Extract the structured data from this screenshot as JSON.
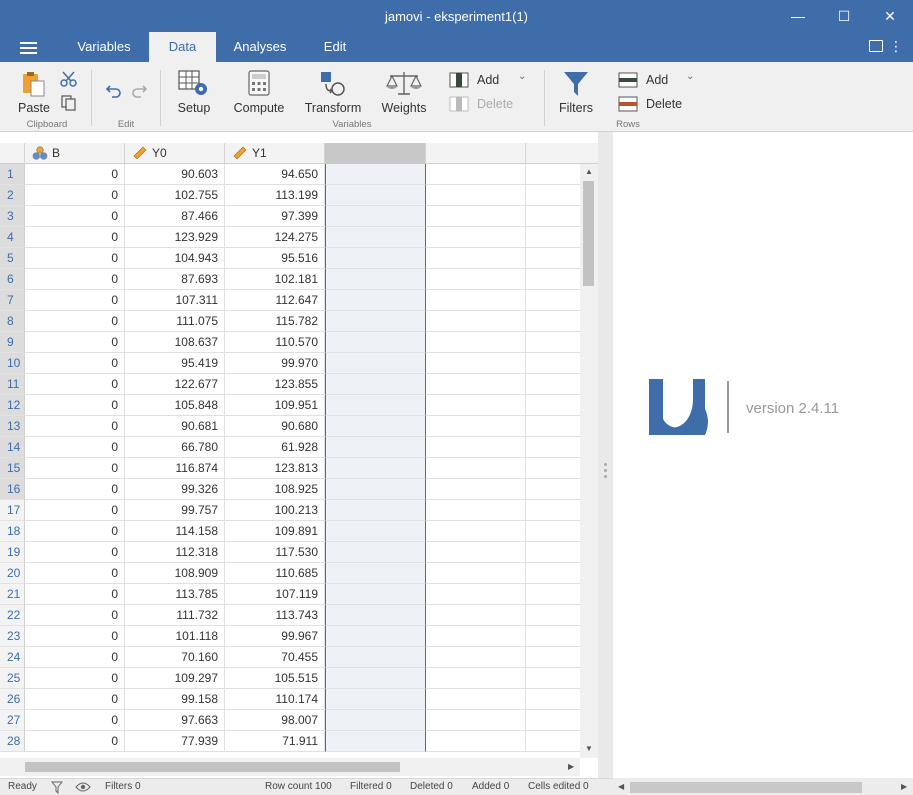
{
  "window": {
    "title": "jamovi - eksperiment1(1)",
    "minimize": "—",
    "maximize": "☐",
    "close": "✕"
  },
  "tabs": [
    {
      "label": "Variables"
    },
    {
      "label": "Data"
    },
    {
      "label": "Analyses"
    },
    {
      "label": "Edit"
    }
  ],
  "ribbon": {
    "paste": "Paste",
    "clipboard_group": "Clipboard",
    "edit_group": "Edit",
    "setup": "Setup",
    "compute": "Compute",
    "transform": "Transform",
    "weights": "Weights",
    "var_add": "Add",
    "var_delete": "Delete",
    "variables_group": "Variables",
    "filters": "Filters",
    "row_add": "Add",
    "row_delete": "Delete",
    "rows_group": "Rows"
  },
  "columns": [
    {
      "name": "B",
      "type": "nominal"
    },
    {
      "name": "Y0",
      "type": "continuous"
    },
    {
      "name": "Y1",
      "type": "continuous"
    }
  ],
  "rows": [
    {
      "n": "1",
      "B": "0",
      "Y0": "90.603",
      "Y1": "94.650"
    },
    {
      "n": "2",
      "B": "0",
      "Y0": "102.755",
      "Y1": "113.199"
    },
    {
      "n": "3",
      "B": "0",
      "Y0": "87.466",
      "Y1": "97.399"
    },
    {
      "n": "4",
      "B": "0",
      "Y0": "123.929",
      "Y1": "124.275"
    },
    {
      "n": "5",
      "B": "0",
      "Y0": "104.943",
      "Y1": "95.516"
    },
    {
      "n": "6",
      "B": "0",
      "Y0": "87.693",
      "Y1": "102.181"
    },
    {
      "n": "7",
      "B": "0",
      "Y0": "107.311",
      "Y1": "112.647"
    },
    {
      "n": "8",
      "B": "0",
      "Y0": "111.075",
      "Y1": "115.782"
    },
    {
      "n": "9",
      "B": "0",
      "Y0": "108.637",
      "Y1": "110.570"
    },
    {
      "n": "10",
      "B": "0",
      "Y0": "95.419",
      "Y1": "99.970"
    },
    {
      "n": "11",
      "B": "0",
      "Y0": "122.677",
      "Y1": "123.855"
    },
    {
      "n": "12",
      "B": "0",
      "Y0": "105.848",
      "Y1": "109.951"
    },
    {
      "n": "13",
      "B": "0",
      "Y0": "90.681",
      "Y1": "90.680"
    },
    {
      "n": "14",
      "B": "0",
      "Y0": "66.780",
      "Y1": "61.928"
    },
    {
      "n": "15",
      "B": "0",
      "Y0": "116.874",
      "Y1": "123.813"
    },
    {
      "n": "16",
      "B": "0",
      "Y0": "99.326",
      "Y1": "108.925"
    },
    {
      "n": "17",
      "B": "0",
      "Y0": "99.757",
      "Y1": "100.213"
    },
    {
      "n": "18",
      "B": "0",
      "Y0": "114.158",
      "Y1": "109.891"
    },
    {
      "n": "19",
      "B": "0",
      "Y0": "112.318",
      "Y1": "117.530"
    },
    {
      "n": "20",
      "B": "0",
      "Y0": "108.909",
      "Y1": "110.685"
    },
    {
      "n": "21",
      "B": "0",
      "Y0": "113.785",
      "Y1": "107.119"
    },
    {
      "n": "22",
      "B": "0",
      "Y0": "111.732",
      "Y1": "113.743"
    },
    {
      "n": "23",
      "B": "0",
      "Y0": "101.118",
      "Y1": "99.967"
    },
    {
      "n": "24",
      "B": "0",
      "Y0": "70.160",
      "Y1": "70.455"
    },
    {
      "n": "25",
      "B": "0",
      "Y0": "109.297",
      "Y1": "105.515"
    },
    {
      "n": "26",
      "B": "0",
      "Y0": "99.158",
      "Y1": "110.174"
    },
    {
      "n": "27",
      "B": "0",
      "Y0": "97.663",
      "Y1": "98.007"
    },
    {
      "n": "28",
      "B": "0",
      "Y0": "77.939",
      "Y1": "71.911"
    }
  ],
  "highlighted_rows": [
    "1",
    "2",
    "3",
    "4",
    "5",
    "6",
    "7",
    "8",
    "9",
    "10",
    "11",
    "12",
    "13",
    "14",
    "15",
    "16"
  ],
  "results": {
    "version": "version 2.4.11"
  },
  "status": {
    "ready": "Ready",
    "filters": "Filters 0",
    "row_count": "Row count 100",
    "filtered": "Filtered 0",
    "deleted": "Deleted 0",
    "added": "Added 0",
    "cells_edited": "Cells edited 0"
  },
  "colors": {
    "accent": "#3e6da9",
    "ribbon_bg": "#f0f0f0",
    "orange": "#f0a030"
  }
}
